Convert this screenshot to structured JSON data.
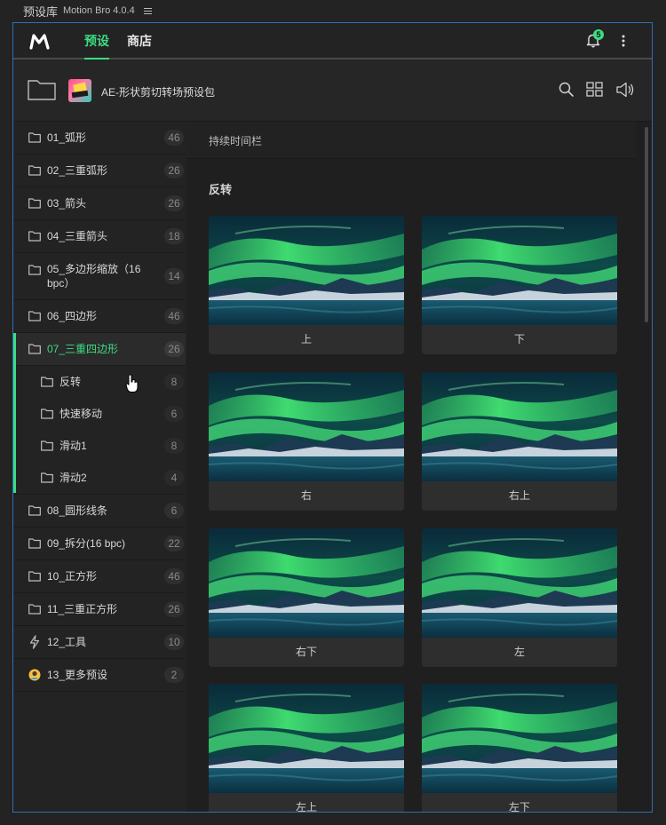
{
  "window": {
    "title": "预设库",
    "subtitle": "Motion Bro 4.0.4"
  },
  "nav": {
    "tabs": [
      {
        "label": "预设",
        "active": true
      },
      {
        "label": "商店",
        "active": false
      }
    ],
    "notification_count": "5",
    "accent_color": "#3ddc84"
  },
  "pack": {
    "name": "AE-形状剪切转场预设包"
  },
  "sidebar": {
    "items": [
      {
        "label": "01_弧形",
        "count": "46",
        "icon": "folder-icon"
      },
      {
        "label": "02_三重弧形",
        "count": "26",
        "icon": "folder-icon"
      },
      {
        "label": "03_箭头",
        "count": "26",
        "icon": "folder-icon"
      },
      {
        "label": "04_三重箭头",
        "count": "18",
        "icon": "folder-icon"
      },
      {
        "label": "05_多边形缩放（16 bpc）",
        "count": "14",
        "icon": "folder-icon"
      },
      {
        "label": "06_四边形",
        "count": "46",
        "icon": "folder-icon"
      },
      {
        "label": "07_三重四边形",
        "count": "26",
        "icon": "folder-icon",
        "active": true
      },
      {
        "label": "反转",
        "count": "8",
        "icon": "folder-icon",
        "sub": true
      },
      {
        "label": "快速移动",
        "count": "6",
        "icon": "folder-icon",
        "sub": true
      },
      {
        "label": "滑动1",
        "count": "8",
        "icon": "folder-icon",
        "sub": true
      },
      {
        "label": "滑动2",
        "count": "4",
        "icon": "folder-icon",
        "sub": true
      },
      {
        "label": "08_圆形线条",
        "count": "6",
        "icon": "folder-icon"
      },
      {
        "label": "09_拆分(16 bpc)",
        "count": "22",
        "icon": "folder-icon"
      },
      {
        "label": "10_正方形",
        "count": "46",
        "icon": "folder-icon"
      },
      {
        "label": "11_三重正方形",
        "count": "26",
        "icon": "folder-icon"
      },
      {
        "label": "12_工具",
        "count": "10",
        "icon": "lightning-icon"
      },
      {
        "label": "13_更多预设",
        "count": "2",
        "icon": "avatar-icon"
      }
    ]
  },
  "content": {
    "subheader": "持续时间栏",
    "section_title": "反转",
    "cards": [
      "上",
      "下",
      "右",
      "右上",
      "右下",
      "左",
      "左上",
      "左下"
    ]
  }
}
